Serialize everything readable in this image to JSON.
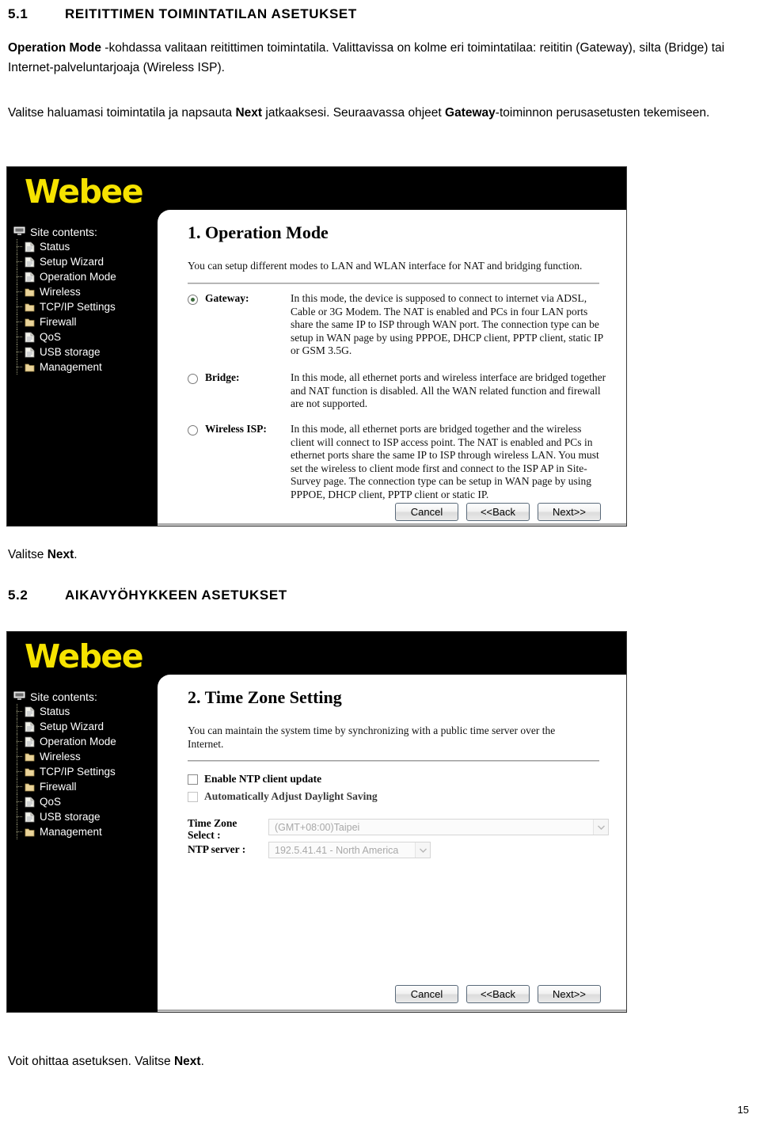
{
  "document": {
    "section_51": {
      "number": "5.1",
      "title": "REITITTIMEN TOIMINTATILAN ASETUKSET"
    },
    "section_52": {
      "number": "5.2",
      "title": "AIKAVYÖHYKKEEN ASETUKSET"
    },
    "paragraph_1_part1_bold": "Operation Mode",
    "paragraph_1_part2": " -kohdassa valitaan reitittimen toimintatila. Valittavissa on kolme eri toimintatilaa: reititin (Gateway), silta (Bridge)  tai Internet-palveluntarjoaja (Wireless ISP).",
    "paragraph_2_part1": "Valitse haluamasi toimintatila ja napsauta ",
    "paragraph_2_bold1": "Next",
    "paragraph_2_part2": " jatkaaksesi. Seuraavassa ohjeet ",
    "paragraph_2_bold2": "Gateway",
    "paragraph_2_part3": "-toiminnon perusasetusten tekemiseen.",
    "caption_after_shot1_part1": "Valitse ",
    "caption_after_shot1_bold": "Next",
    "caption_after_shot1_part2": ".",
    "caption_after_shot2_part1": "Voit ohittaa asetuksen. Valitse ",
    "caption_after_shot2_bold": "Next",
    "caption_after_shot2_part2": ".",
    "page_number": "15"
  },
  "router_ui": {
    "brand": "Webee",
    "brand_color": "#f6e300",
    "sidebar": {
      "root_label": "Site contents:",
      "root_icon": "computer-icon",
      "items": [
        {
          "label": "Status",
          "icon": "page-icon"
        },
        {
          "label": "Setup Wizard",
          "icon": "page-icon"
        },
        {
          "label": "Operation Mode",
          "icon": "page-icon"
        },
        {
          "label": "Wireless",
          "icon": "folder-icon"
        },
        {
          "label": "TCP/IP Settings",
          "icon": "folder-icon"
        },
        {
          "label": "Firewall",
          "icon": "folder-icon"
        },
        {
          "label": "QoS",
          "icon": "page-icon"
        },
        {
          "label": "USB storage",
          "icon": "page-icon"
        },
        {
          "label": "Management",
          "icon": "folder-icon"
        }
      ]
    },
    "buttons": {
      "cancel": "Cancel",
      "back": "<<Back",
      "next": "Next>>"
    }
  },
  "screen_operation_mode": {
    "title": "1. Operation Mode",
    "description": "You can setup different modes to LAN and WLAN interface for NAT and bridging function.",
    "modes": [
      {
        "label": "Gateway:",
        "selected": true,
        "text": "In this mode, the device is supposed to connect to internet via ADSL, Cable or 3G Modem. The NAT is enabled and PCs in four LAN ports share the same IP to ISP through WAN port. The connection type can be setup in WAN page by using PPPOE, DHCP client, PPTP client, static IP or GSM 3.5G."
      },
      {
        "label": "Bridge:",
        "selected": false,
        "text": "In this mode, all ethernet ports and wireless interface are bridged together and NAT function is disabled. All the WAN related function and firewall are not supported."
      },
      {
        "label": "Wireless ISP:",
        "selected": false,
        "text": "In this mode, all ethernet ports are bridged together and the wireless client will connect to ISP access point. The NAT is enabled and PCs in ethernet ports share the same IP to ISP through wireless LAN. You must set the wireless to client mode first and connect to the ISP AP in Site-Survey page. The connection type can be setup in WAN page by using PPPOE, DHCP client, PPTP client or static IP."
      }
    ]
  },
  "screen_time_zone": {
    "title": "2. Time Zone Setting",
    "description": "You can maintain the system time by synchronizing with a public time server over the Internet.",
    "checkboxes": [
      {
        "label": "Enable NTP client update",
        "checked": false
      },
      {
        "label": "Automatically Adjust Daylight Saving",
        "checked": false
      }
    ],
    "time_zone_label": "Time Zone Select :",
    "time_zone_label_line1": "Time Zone",
    "time_zone_label_line2": "Select :",
    "time_zone_value": "(GMT+08:00)Taipei",
    "ntp_label": "NTP server :",
    "ntp_value": "192.5.41.41 - North America"
  }
}
